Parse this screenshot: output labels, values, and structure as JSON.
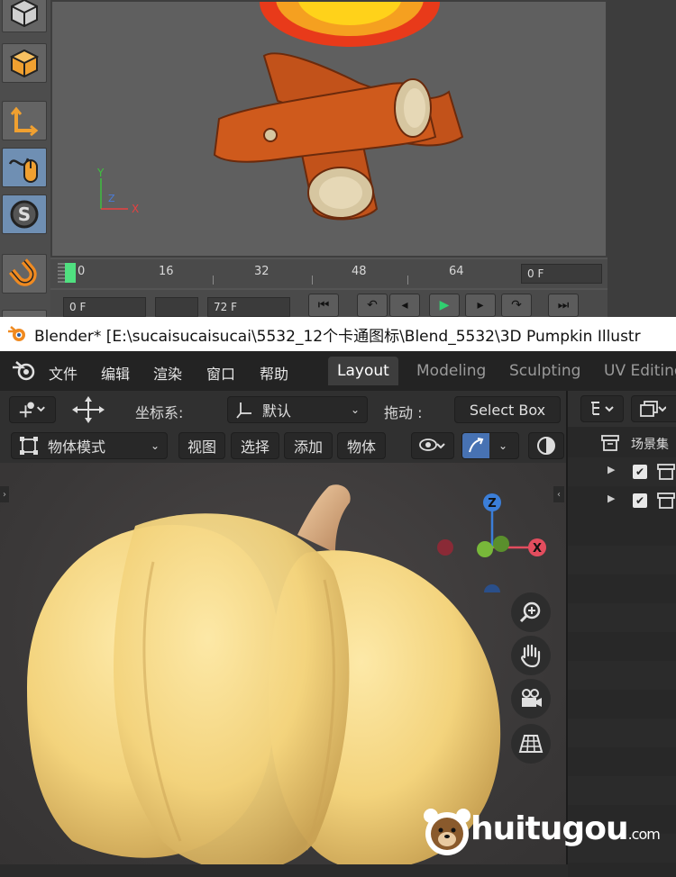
{
  "c4d": {
    "timeline_ticks": [
      "0",
      "16",
      "32",
      "48",
      "64"
    ],
    "end_frame_field": "0 F",
    "start_field": "0 F",
    "end_field": "72 F"
  },
  "title": {
    "text": "Blender* [E:\\sucaisucaisucai\\5532_12个卡通图标\\Blend_5532\\3D Pumpkin Illustr"
  },
  "menu": {
    "items": [
      "文件",
      "编辑",
      "渲染",
      "窗口",
      "帮助"
    ],
    "workspaces": [
      "Layout",
      "Modeling",
      "Sculpting",
      "UV Editing"
    ]
  },
  "header1": {
    "coord_label": "坐标系:",
    "coord_value": "默认",
    "drag_label": "拖动 :",
    "drag_value": "Select Box"
  },
  "header2": {
    "mode": "物体模式",
    "view": "视图",
    "select": "选择",
    "add": "添加",
    "object": "物体"
  },
  "gizmo": {
    "z": "Z",
    "x": "X"
  },
  "outliner": {
    "scene_collection": "场景集"
  },
  "watermark": {
    "text": "huitugou",
    "suffix": ".com"
  },
  "colors": {
    "blender_accent": "#4772b3",
    "gizmo_x": "#e34d5e",
    "gizmo_y": "#78b83a",
    "gizmo_z": "#3b7ed8"
  }
}
